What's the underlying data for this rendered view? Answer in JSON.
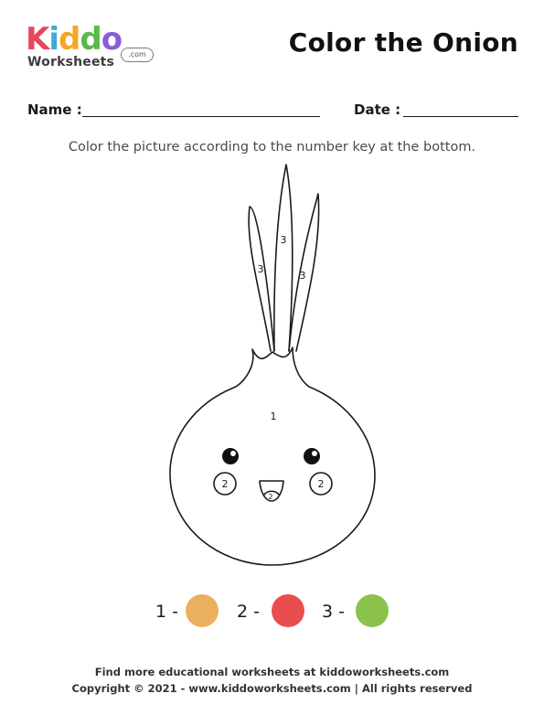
{
  "logo": {
    "brand_letters": [
      "K",
      "i",
      "d",
      "d",
      "o"
    ],
    "brand_colors": [
      "#e8465e",
      "#3fa9d8",
      "#f4a62a",
      "#5bb84a",
      "#8e5bd6"
    ],
    "subtitle": "Worksheets",
    "suffix": ".com"
  },
  "title": "Color the Onion",
  "fields": {
    "name_label": "Name :",
    "date_label": "Date :"
  },
  "instruction": "Color the picture according to the number key at the bottom.",
  "art": {
    "region_labels": {
      "body": "1",
      "left_cheek": "2",
      "right_cheek": "2",
      "mouth": "2",
      "leaf_left": "3",
      "leaf_middle": "3",
      "leaf_right": "3"
    }
  },
  "key": [
    {
      "label": "1 -",
      "color": "#ebb05f"
    },
    {
      "label": "2 -",
      "color": "#ea4d4d"
    },
    {
      "label": "3 -",
      "color": "#8ac24a"
    }
  ],
  "footer": {
    "line1": "Find more educational worksheets at kiddoworksheets.com",
    "line2": "Copyright © 2021 - www.kiddoworksheets.com  |  All rights reserved"
  }
}
